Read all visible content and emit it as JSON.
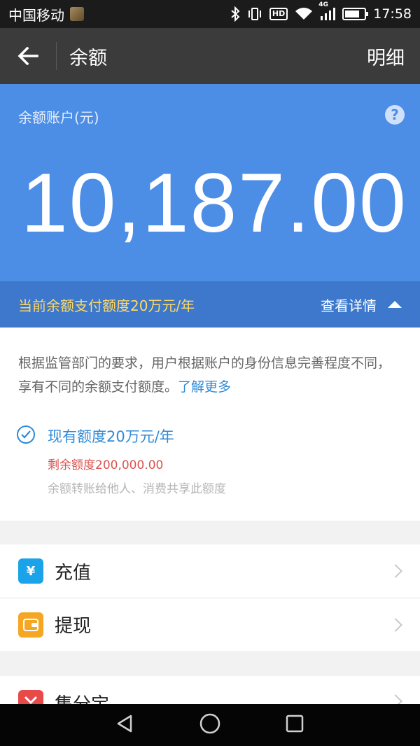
{
  "status_bar": {
    "carrier": "中国移动",
    "network": "4G",
    "time": "17:58",
    "hd_label": "HD",
    "battery_level": 0.65
  },
  "header": {
    "title": "余额",
    "detail_label": "明细"
  },
  "balance": {
    "label": "余额账户(元)",
    "amount": "10,187.00",
    "help_icon": "?"
  },
  "limit_bar": {
    "text": "当前余额支付额度20万元/年",
    "detail_label": "查看详情"
  },
  "info": {
    "description": "根据监管部门的要求，用户根据账户的身份信息完善程度不同，享有不同的余额支付额度。",
    "learn_more": "了解更多",
    "current_quota": "现有额度20万元/年",
    "remaining": "剩余额度200,000.00",
    "note": "余额转账给他人、消费共享此额度"
  },
  "actions": [
    {
      "label": "充值",
      "icon": "recharge-icon",
      "color": "#1aa3e8",
      "glyph": "¥"
    },
    {
      "label": "提现",
      "icon": "wallet-icon",
      "color": "#f5a623",
      "glyph": ""
    }
  ],
  "more": [
    {
      "label": "集分宝",
      "icon": "jifenbao-icon",
      "color": "#e84a4a"
    }
  ],
  "colors": {
    "primary": "#4c8de6",
    "limit_bar": "#3d78cc",
    "quota_text": "#2f8ad8",
    "warning": "#d9534f"
  }
}
